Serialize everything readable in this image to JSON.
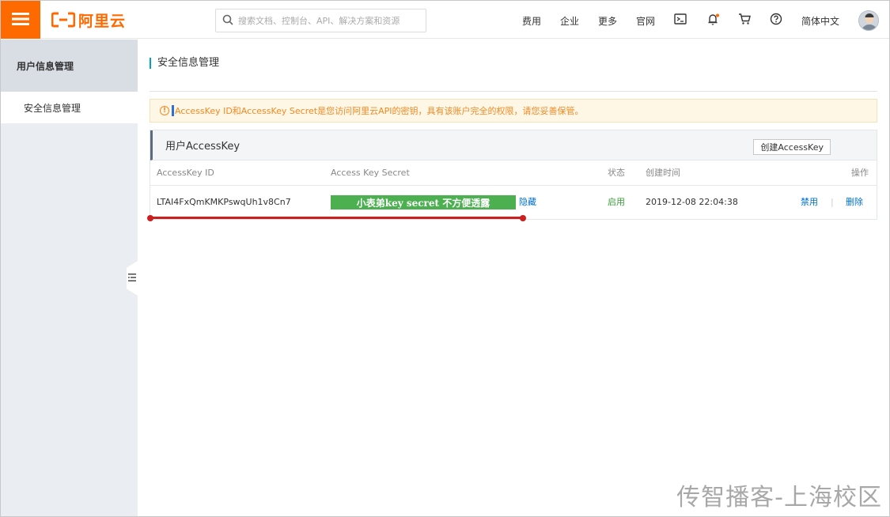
{
  "header": {
    "logo_text": "阿里云",
    "search_placeholder": "搜索文档、控制台、API、解决方案和资源",
    "nav": {
      "fees": "费用",
      "enterprise": "企业",
      "more": "更多",
      "official_site": "官网",
      "language": "简体中文"
    },
    "icons": [
      "menu-icon",
      "search-icon",
      "terminal-icon",
      "bell-icon",
      "cart-icon",
      "help-icon"
    ],
    "brand_color": "#ff6a00"
  },
  "sidebar": {
    "title": "用户信息管理",
    "items": [
      {
        "label": "安全信息管理"
      }
    ]
  },
  "main": {
    "page_title": "安全信息管理",
    "alert": "AccessKey ID和AccessKey Secret是您访问阿里云API的密钥，具有该账户完全的权限，请您妥善保管。",
    "panel": {
      "title": "用户AccessKey",
      "create_button": "创建AccessKey",
      "columns": {
        "id": "AccessKey ID",
        "secret": "Access Key Secret",
        "status": "状态",
        "created": "创建时间",
        "actions": "操作"
      },
      "rows": [
        {
          "id": "LTAI4FxQmKMKPswqUh1v8Cn7",
          "secret_overlay": "小表弟key secret 不方便透露",
          "hide_link": "隐藏",
          "status": "启用",
          "created": "2019-12-08 22:04:38",
          "disable": "禁用",
          "delete": "删除"
        }
      ]
    }
  },
  "watermark": "传智播客-上海校区"
}
